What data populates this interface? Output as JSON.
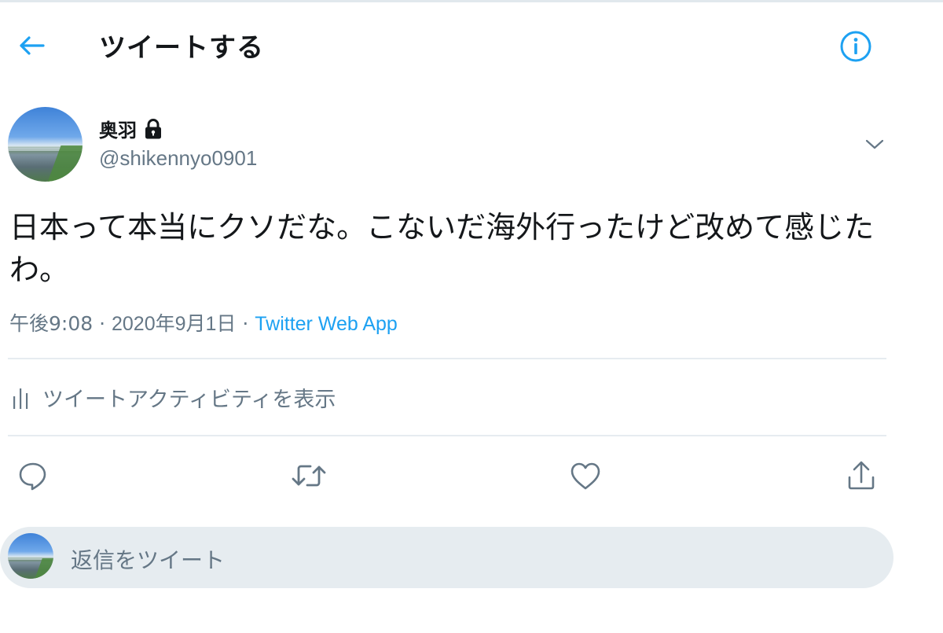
{
  "header": {
    "title": "ツイートする",
    "back_icon": "arrow-left-icon",
    "info_icon": "info-circle-icon",
    "accent": "#1da1f2"
  },
  "user": {
    "name": "奥羽",
    "handle": "@shikennyo0901",
    "lock_icon": "lock-icon"
  },
  "tweet": {
    "text": "日本って本当にクソだな。こないだ海外行ったけど改めて感じたわ。",
    "time": "午後9:08",
    "separator": " · ",
    "date": "2020年9月1日",
    "source": "Twitter Web App"
  },
  "activity": {
    "label": "ツイートアクティビティを表示"
  },
  "actions": [
    "reply-icon",
    "retweet-icon",
    "like-icon",
    "share-icon"
  ],
  "reply": {
    "placeholder": "返信をツイート"
  },
  "colors": {
    "text": "#14171a",
    "secondary": "#657786",
    "divider": "#e6ecf0",
    "reply_bg": "#e6ecf0"
  }
}
